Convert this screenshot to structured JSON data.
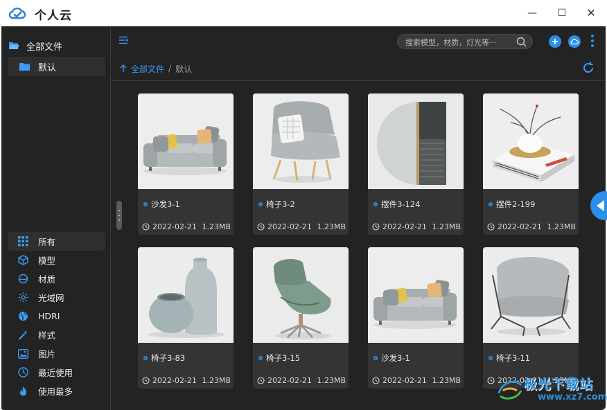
{
  "app": {
    "title": "个人云"
  },
  "window_controls": {
    "minimize": "—",
    "maximize": "☐",
    "close": "✕"
  },
  "sidebar": {
    "root_label": "全部文件",
    "sub_label": "默认",
    "categories": [
      {
        "label": "所有",
        "icon": "grid-icon",
        "active": true
      },
      {
        "label": "模型",
        "icon": "cube-icon"
      },
      {
        "label": "材质",
        "icon": "material-icon"
      },
      {
        "label": "光域网",
        "icon": "light-icon"
      },
      {
        "label": "HDRI",
        "icon": "globe-icon"
      },
      {
        "label": "样式",
        "icon": "wand-icon"
      },
      {
        "label": "图片",
        "icon": "image-icon"
      },
      {
        "label": "最近使用",
        "icon": "clock-icon"
      },
      {
        "label": "使用最多",
        "icon": "fire-icon"
      }
    ]
  },
  "toolbar": {
    "search_placeholder": "搜索模型，材质，灯光等···"
  },
  "breadcrumb": {
    "root": "全部文件",
    "separator": "/",
    "current": "默认"
  },
  "items": [
    {
      "name": "沙发3-1",
      "date": "2022-02-21",
      "size": "1.23MB",
      "thumb": "sofa"
    },
    {
      "name": "椅子3-2",
      "date": "2022-02-21",
      "size": "1.23MB",
      "thumb": "lounge-chair"
    },
    {
      "name": "摆件3-124",
      "date": "2022-02-21",
      "size": "1.23MB",
      "thumb": "round-panel"
    },
    {
      "name": "摆件2-199",
      "date": "2022-02-21",
      "size": "1.23MB",
      "thumb": "vase-books"
    },
    {
      "name": "椅子3-83",
      "date": "2022-02-21",
      "size": "1.23MB",
      "thumb": "vases"
    },
    {
      "name": "椅子3-15",
      "date": "2022-02-21",
      "size": "1.23MB",
      "thumb": "egg-chair"
    },
    {
      "name": "沙发3-1",
      "date": "2022-02-21",
      "size": "1.23MB",
      "thumb": "sofa"
    },
    {
      "name": "椅子3-11",
      "date": "2022-02-21",
      "size": "1.23MB",
      "thumb": "armchair"
    }
  ],
  "watermark": {
    "text": "极光下载站",
    "url": "www.xz7.com"
  },
  "colors": {
    "accent": "#2b8ee8",
    "background": "#232323",
    "card": "#343434"
  }
}
